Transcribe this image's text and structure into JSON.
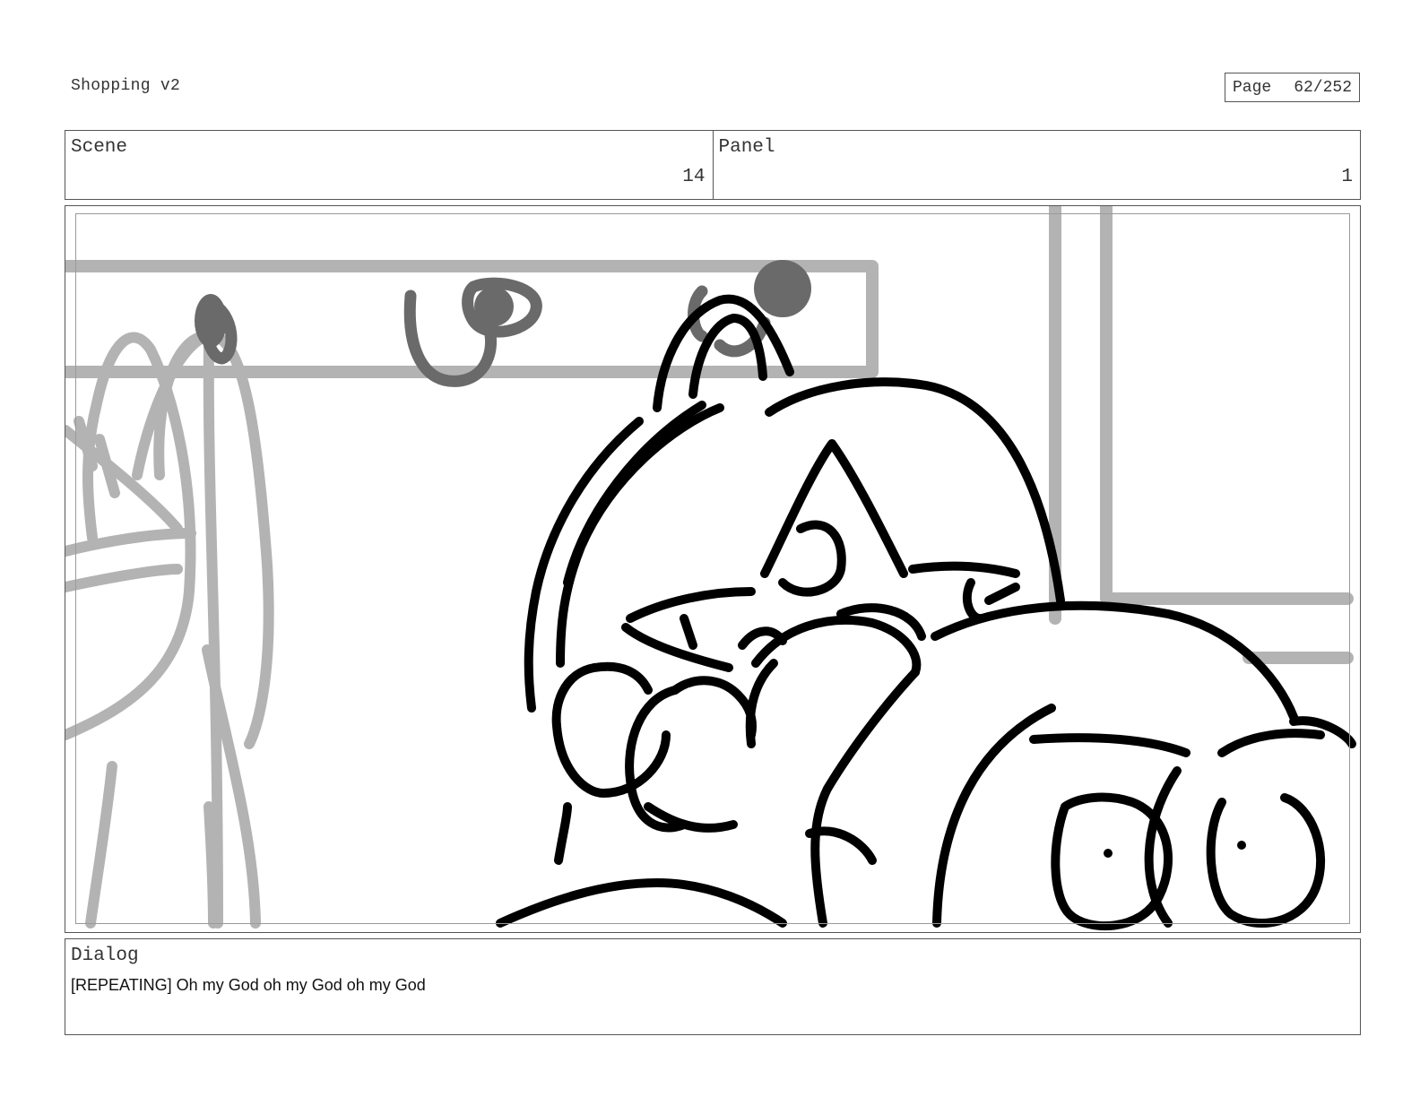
{
  "header": {
    "title": "Shopping v2",
    "page_label": "Page",
    "page_number": "62/252"
  },
  "info": {
    "scene_label": "Scene",
    "scene_value": "14",
    "panel_label": "Panel",
    "panel_value": "1"
  },
  "frame": {
    "colors": {
      "line": "#000000",
      "rough": "#b3b3b3",
      "dark": "#6a6a6a"
    }
  },
  "dialog": {
    "label": "Dialog",
    "text": "[REPEATING] Oh my God oh my God oh my God"
  }
}
